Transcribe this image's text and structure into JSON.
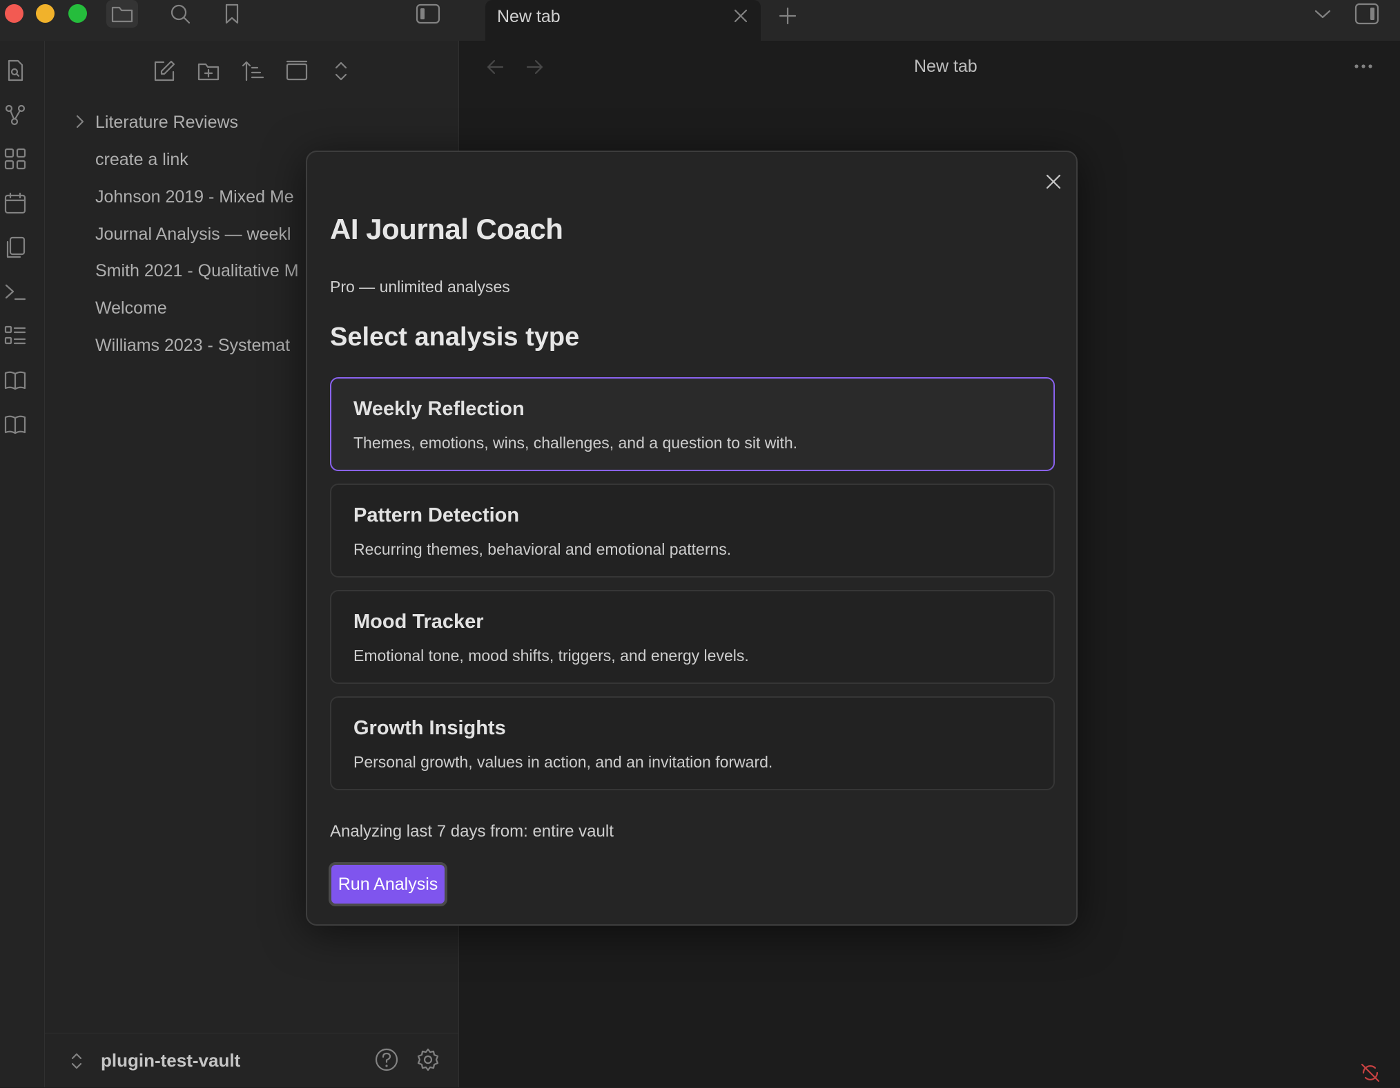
{
  "titlebar": {
    "traffic_lights": {
      "close": "#ff5f57",
      "minimize": "#febc2e",
      "maximize": "#28c840"
    },
    "icons": [
      "folder-icon",
      "search-icon",
      "bookmark-icon",
      "sidebar-toggle-icon"
    ],
    "tab": {
      "label": "New tab"
    },
    "right_icons": [
      "chevron-down-icon",
      "right-sidebar-toggle-icon"
    ]
  },
  "ribbon": {
    "icons": [
      "file-search-icon",
      "graph-icon",
      "canvas-grid-icon",
      "calendar-icon",
      "copy-icon",
      "terminal-icon",
      "list-icon",
      "book-open-icon",
      "book-open-icon"
    ]
  },
  "sidebar": {
    "tools": [
      "new-note-icon",
      "new-folder-icon",
      "sort-icon",
      "collapse-icon",
      "expand-icon"
    ],
    "files": [
      {
        "label": "Literature Reviews",
        "type": "folder"
      },
      {
        "label": "create a link",
        "type": "file"
      },
      {
        "label": "Johnson 2019 - Mixed Me",
        "type": "file"
      },
      {
        "label": "Journal Analysis — weekl",
        "type": "file"
      },
      {
        "label": "Smith 2021 - Qualitative M",
        "type": "file"
      },
      {
        "label": "Welcome",
        "type": "file"
      },
      {
        "label": "Williams 2023 - Systemat",
        "type": "file"
      }
    ],
    "vault": {
      "name": "plugin-test-vault"
    }
  },
  "main": {
    "title": "New tab"
  },
  "modal": {
    "title": "AI Journal Coach",
    "plan": "Pro — unlimited analyses",
    "section_title": "Select analysis type",
    "options": [
      {
        "title": "Weekly Reflection",
        "desc": "Themes, emotions, wins, challenges, and a question to sit with.",
        "selected": true
      },
      {
        "title": "Pattern Detection",
        "desc": "Recurring themes, behavioral and emotional patterns.",
        "selected": false
      },
      {
        "title": "Mood Tracker",
        "desc": "Emotional tone, mood shifts, triggers, and energy levels.",
        "selected": false
      },
      {
        "title": "Growth Insights",
        "desc": "Personal growth, values in action, and an invitation forward.",
        "selected": false
      }
    ],
    "scope_text": "Analyzing last 7 days from: entire vault",
    "run_label": "Run Analysis",
    "accent": "#7f55ee"
  }
}
